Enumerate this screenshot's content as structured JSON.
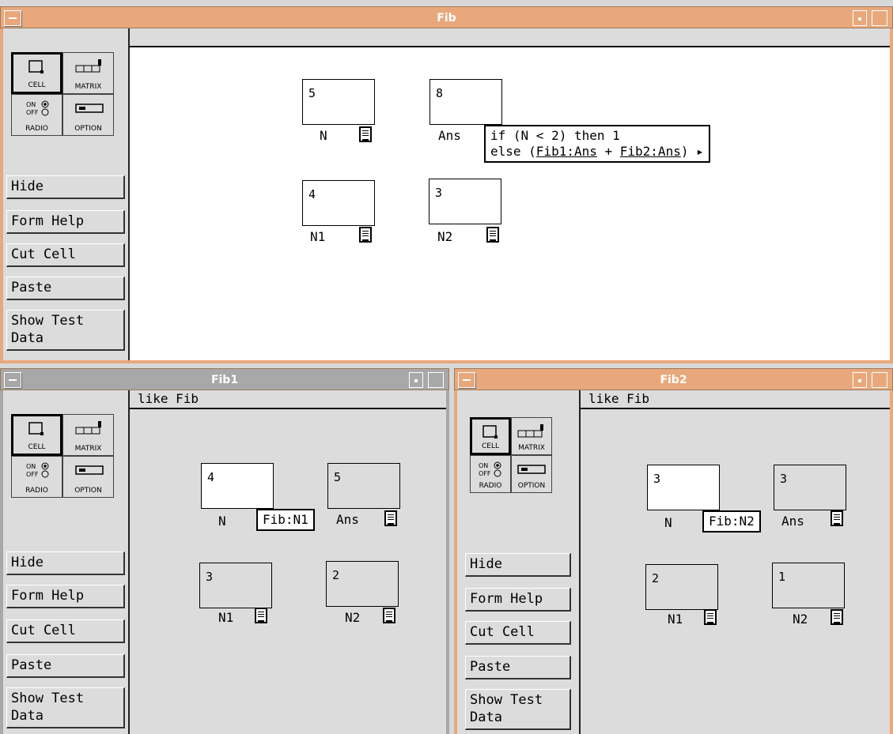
{
  "palette": {
    "cell": "CELL",
    "matrix": "MATRIX",
    "radio": "RADIO",
    "option": "OPTION",
    "on": "ON",
    "off": "OFF"
  },
  "buttons": {
    "hide": "Hide",
    "form_help": "Form Help",
    "cut_cell": "Cut Cell",
    "paste": "Paste",
    "show_test_data": "Show Test Data"
  },
  "fib": {
    "title": "Fib",
    "header": "",
    "cells": {
      "n": {
        "label": "N",
        "value": "5"
      },
      "ans": {
        "label": "Ans",
        "value": "8"
      },
      "n1": {
        "label": "N1",
        "value": "4"
      },
      "n2": {
        "label": "N2",
        "value": "3"
      }
    },
    "formula": {
      "line1": "if (N < 2) then 1",
      "line2_prefix": "else (",
      "ref1": "Fib1:Ans",
      "plus": " + ",
      "ref2": "Fib2:Ans",
      "line2_suffix": ")",
      "arrow": "▸"
    }
  },
  "fib1": {
    "title": "Fib1",
    "header": "like Fib",
    "cells": {
      "n": {
        "label": "N",
        "value": "4"
      },
      "ans": {
        "label": "Ans",
        "value": "5"
      },
      "n1": {
        "label": "N1",
        "value": "3"
      },
      "n2": {
        "label": "N2",
        "value": "2"
      }
    },
    "popup": "Fib:N1"
  },
  "fib2": {
    "title": "Fib2",
    "header": "like Fib",
    "cells": {
      "n": {
        "label": "N",
        "value": "3"
      },
      "ans": {
        "label": "Ans",
        "value": "3"
      },
      "n1": {
        "label": "N1",
        "value": "2"
      },
      "n2": {
        "label": "N2",
        "value": "1"
      }
    },
    "popup": "Fib:N2"
  },
  "colors": {
    "active_title": "#e9a87c",
    "inactive_title": "#a8a8a8",
    "panel": "#dcdcdc"
  }
}
